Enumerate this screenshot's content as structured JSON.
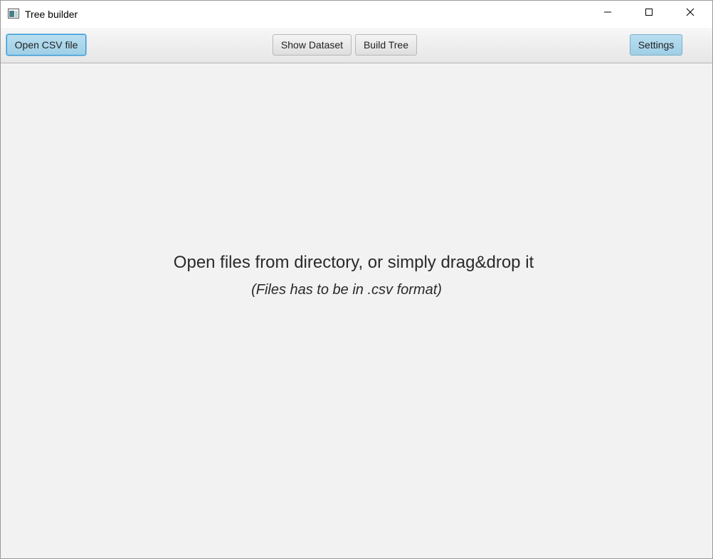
{
  "window": {
    "title": "Tree builder",
    "icon": "app-window-icon",
    "controls": {
      "minimize_icon": "minimize-icon",
      "maximize_icon": "maximize-icon",
      "close_icon": "close-icon"
    }
  },
  "toolbar": {
    "open_csv_label": "Open CSV file",
    "show_dataset_label": "Show Dataset",
    "build_tree_label": "Build Tree",
    "settings_label": "Settings"
  },
  "main": {
    "hint_primary": "Open files from directory, or simply drag&drop it",
    "hint_secondary": "(Files has to be in .csv format)"
  },
  "colors": {
    "accent_button": "#a9d6ec",
    "focus_border": "#3a97d4",
    "background": "#f2f2f2"
  }
}
